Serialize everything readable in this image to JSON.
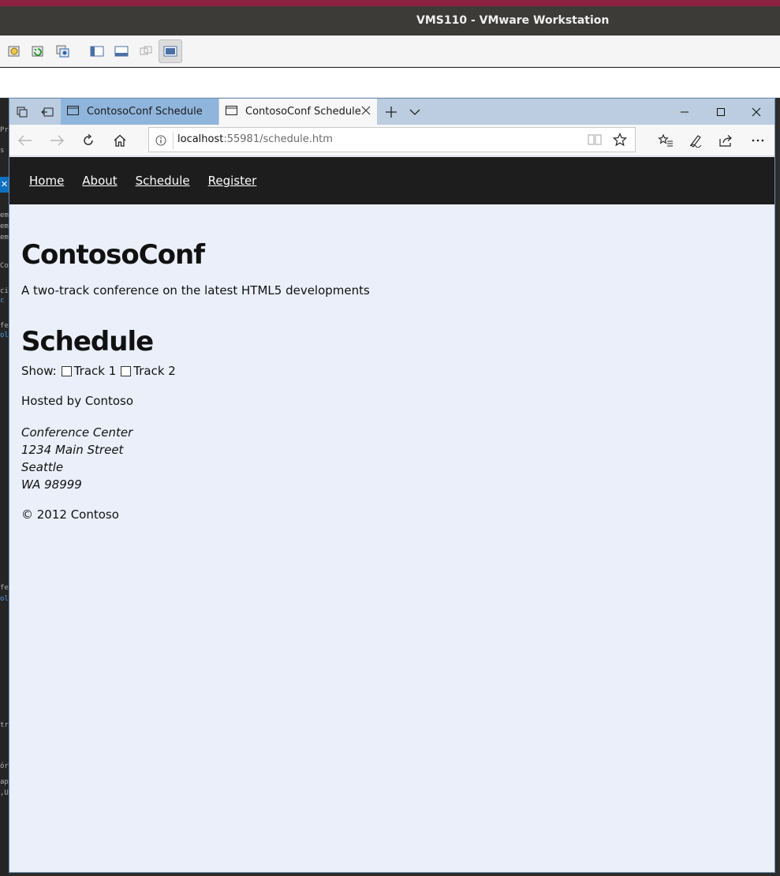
{
  "vmware": {
    "title": "VMS110 - VMware Workstation",
    "toolbar_icons": [
      "snapshot-icon",
      "revert-snapshot-icon",
      "snapshot-manager-icon",
      "sidebar-icon",
      "thumbnail-bar-icon",
      "unity-icon",
      "full-screen-icon"
    ]
  },
  "browser": {
    "tabs": [
      {
        "title": "ContosoConf Schedule",
        "active": false
      },
      {
        "title": "ContosoConf Schedule",
        "active": true
      }
    ],
    "url_host": "localhost",
    "url_rest": ":55981/schedule.htm"
  },
  "page": {
    "nav": [
      {
        "label": "Home"
      },
      {
        "label": "About"
      },
      {
        "label": "Schedule"
      },
      {
        "label": "Register"
      }
    ],
    "site_title": "ContosoConf",
    "tagline": "A two-track conference on the latest HTML5 developments",
    "schedule_heading": "Schedule",
    "filter": {
      "show_label": "Show:",
      "track1_label": "Track 1",
      "track2_label": "Track 2"
    },
    "hosted_by": "Hosted by Contoso",
    "address": [
      "Conference Center",
      "1234 Main Street",
      "Seattle",
      "WA 98999"
    ],
    "copyright": "© 2012 Contoso"
  },
  "colors": {
    "vm_accent": "#8b2242",
    "page_background": "#eaeffa",
    "site_nav_background": "#1d1d1d",
    "active_tab": "#f7f7f7",
    "inactive_tab": "#8fb5dc"
  }
}
